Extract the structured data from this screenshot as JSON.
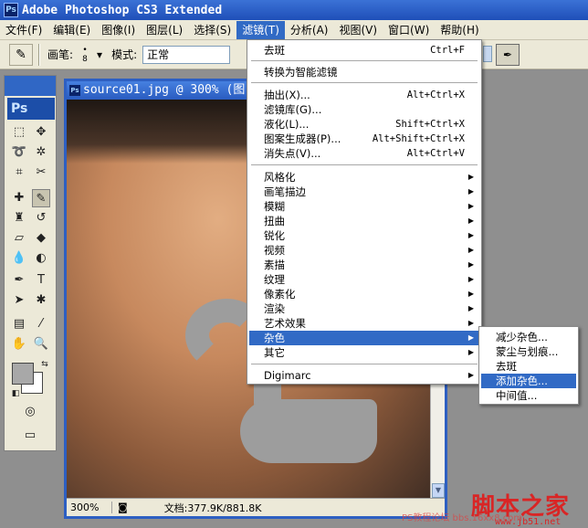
{
  "titlebar": {
    "title": "Adobe Photoshop CS3 Extended",
    "logo": "Ps"
  },
  "menubar": {
    "items": [
      "文件(F)",
      "编辑(E)",
      "图像(I)",
      "图层(L)",
      "选择(S)",
      "滤镜(T)",
      "分析(A)",
      "视图(V)",
      "窗口(W)",
      "帮助(H)"
    ],
    "active_index": 5
  },
  "options": {
    "brush_label": "画笔:",
    "brush_size": "8",
    "mode_label": "模式:",
    "mode_value": "正常"
  },
  "toolbox": {
    "logo": "Ps"
  },
  "document": {
    "title": "source01.jpg @ 300% (图",
    "icon": "Ps",
    "zoom": "300%",
    "doc_size": "文档:377.9K/881.8K"
  },
  "filter_menu": {
    "group1": [
      {
        "label": "去斑",
        "shortcut": "Ctrl+F"
      }
    ],
    "group2": [
      {
        "label": "转换为智能滤镜"
      }
    ],
    "group3": [
      {
        "label": "抽出(X)...",
        "shortcut": "Alt+Ctrl+X"
      },
      {
        "label": "滤镜库(G)..."
      },
      {
        "label": "液化(L)...",
        "shortcut": "Shift+Ctrl+X"
      },
      {
        "label": "图案生成器(P)...",
        "shortcut": "Alt+Shift+Ctrl+X"
      },
      {
        "label": "消失点(V)...",
        "shortcut": "Alt+Ctrl+V"
      }
    ],
    "group4": [
      "风格化",
      "画笔描边",
      "模糊",
      "扭曲",
      "锐化",
      "视频",
      "素描",
      "纹理",
      "像素化",
      "渲染",
      "艺术效果",
      "杂色",
      "其它"
    ],
    "group4_highlight": "杂色",
    "group5": [
      "Digimarc"
    ]
  },
  "noise_submenu": {
    "items": [
      "减少杂色...",
      "蒙尘与划痕...",
      "去斑",
      "添加杂色...",
      "中间值..."
    ],
    "highlight": "添加杂色..."
  },
  "watermark": {
    "text": "脚本之家",
    "url": "www.jb51.net",
    "faint": "PS教程论坛 bbs.16xx8.com"
  },
  "colors": {
    "menu_highlight": "#316ac5",
    "titlebar": "#1f4fb8",
    "foreground_swatch": "#a8a8a8"
  }
}
